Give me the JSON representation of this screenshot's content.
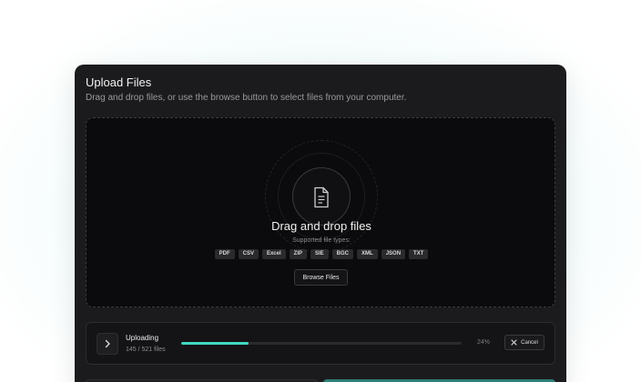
{
  "dialog": {
    "title": "Upload Files",
    "subtitle": "Drag and drop files, or use the browse button to select files from your computer."
  },
  "dropzone": {
    "icon": "file-icon",
    "title": "Drag and drop files",
    "types_label": "Supported file types:",
    "file_types": [
      "PDF",
      "CSV",
      "Excel",
      "ZIP",
      "SIE",
      "BGC",
      "XML",
      "JSON",
      "TXT"
    ],
    "browse_label": "Browse Files"
  },
  "upload": {
    "expand_icon": "chevron-right-icon",
    "status_label": "Uploading",
    "count_text": "145 / 521 files",
    "progress_percent": 24,
    "percent_text": "24%",
    "cancel_icon": "close-icon",
    "cancel_label": "Cancel"
  },
  "colors": {
    "accent": "#3fd9c1",
    "primary_button": "#2f7f78",
    "card_background": "#1b1b1d"
  }
}
